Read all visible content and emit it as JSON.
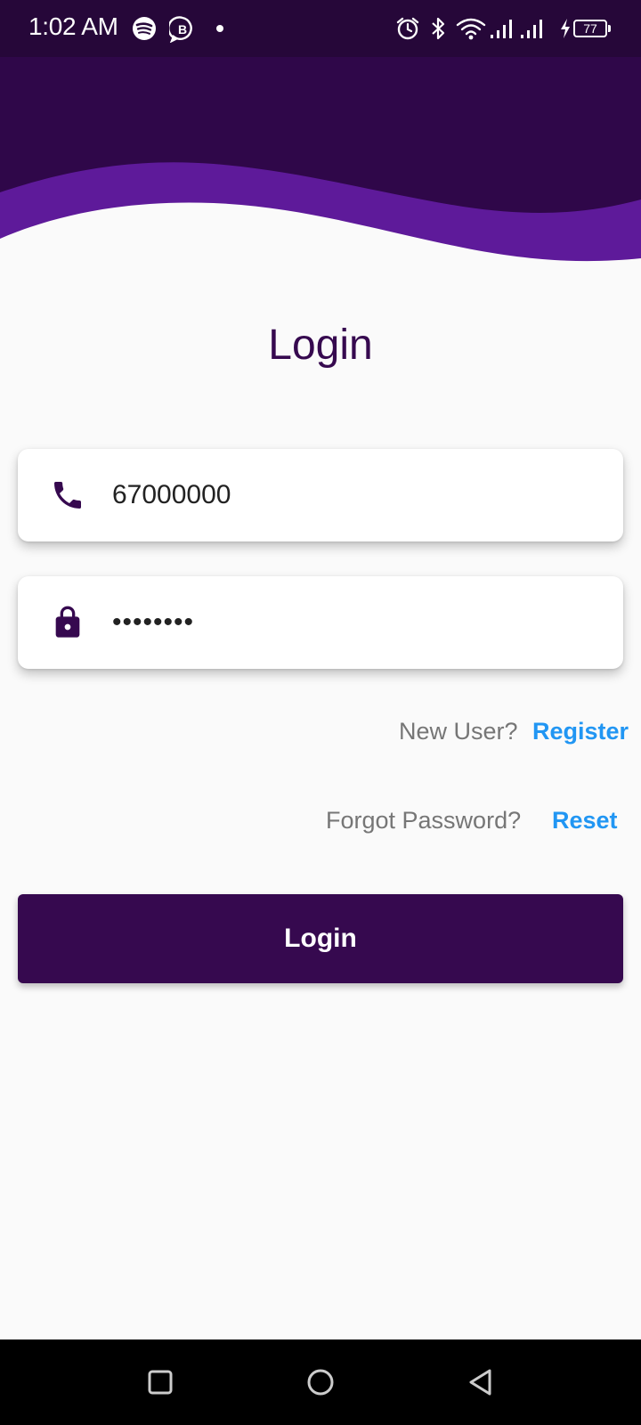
{
  "status_bar": {
    "time": "1:02 AM",
    "battery": "77",
    "icons": [
      "spotify-icon",
      "b-icon",
      "dot-icon",
      "alarm-icon",
      "bluetooth-icon",
      "wifi-icon",
      "signal-icon",
      "signal-icon",
      "charging-icon",
      "battery-icon"
    ]
  },
  "login": {
    "title": "Login",
    "phone_value": "67000000",
    "password_value": "••••••••",
    "new_user_prompt": "New User?",
    "register_link": "Register",
    "forgot_prompt": "Forgot Password?",
    "reset_link": "Reset",
    "button_label": "Login"
  },
  "navigation": {
    "buttons": [
      "recent-apps-icon",
      "home-icon",
      "back-icon"
    ]
  },
  "colors": {
    "primary": "#36094f",
    "header_dark": "#2f0749",
    "wave_accent": "#5e1a9a",
    "link": "#2196f3",
    "background": "#fafafa"
  }
}
